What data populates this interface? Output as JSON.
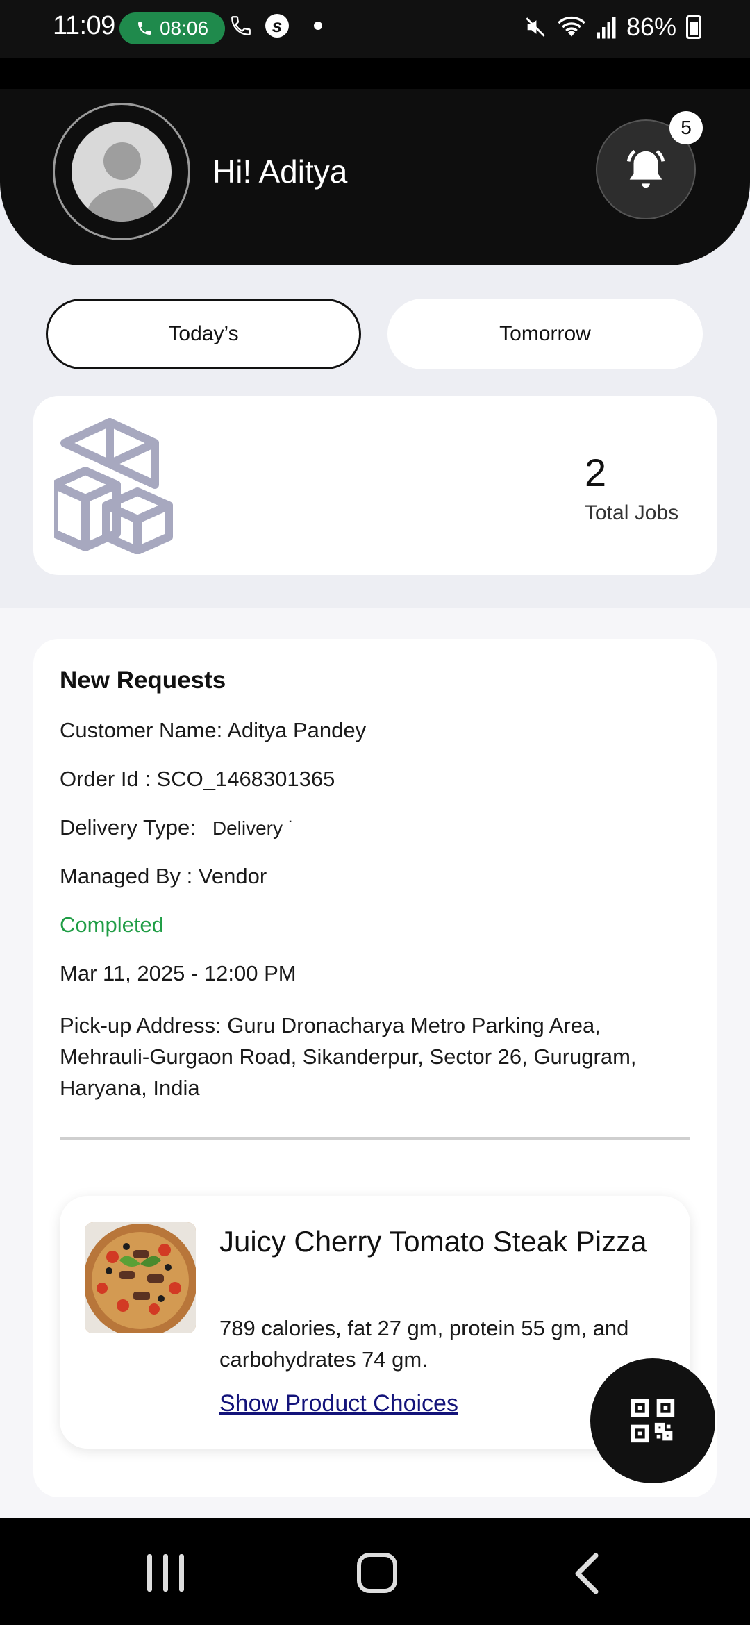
{
  "status_bar": {
    "time": "11:09",
    "call_timer": "08:06",
    "battery": "86%",
    "icons": [
      "phone-icon",
      "wifi-call-icon",
      "s-app-icon",
      "notification-dot",
      "mute-icon",
      "wifi-icon",
      "signal-icon",
      "battery-icon"
    ]
  },
  "header": {
    "greeting": "Hi! Aditya",
    "notification_count": "5"
  },
  "tabs": {
    "today": "Today’s",
    "tomorrow": "Tomorrow"
  },
  "jobs": {
    "count": "2",
    "label": "Total Jobs"
  },
  "request": {
    "title": "New Requests",
    "customer": "Customer Name: Aditya Pandey",
    "order_id": "Order Id : SCO_1468301365",
    "delivery_type_label": "Delivery Type:",
    "delivery_type_value": "Delivery ˙",
    "managed_by": "Managed By : Vendor",
    "status": "Completed",
    "status_color": "#1f9d45",
    "datetime": "Mar 11, 2025 - 12:00 PM",
    "pickup_address": "Pick-up Address: Guru Dronacharya Metro Parking Area, Mehrauli-Gurgaon Road, Sikanderpur, Sector 26, Gurugram, Haryana, India"
  },
  "product": {
    "name": "Juicy Cherry Tomato Steak Pizza",
    "description": "789 calories, fat 27 gm, protein 55 gm, and carbohydrates 74 gm.",
    "link": "Show Product Choices"
  }
}
